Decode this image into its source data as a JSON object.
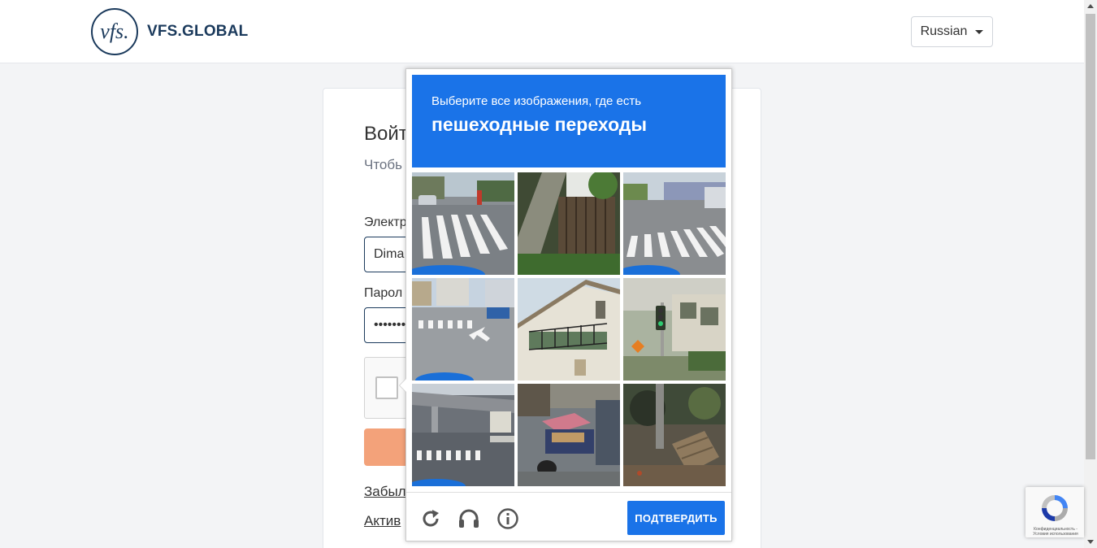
{
  "header": {
    "logo_mark": "vfs.",
    "logo_text": "VFS.GLOBAL",
    "language_selected": "Russian"
  },
  "login": {
    "title": "Войт",
    "subtitle": "Чтобь почты",
    "email_label": "Электр",
    "email_value": "Dima",
    "password_label": "Парол",
    "password_value": "•••••••",
    "forgot_link": "Забыл",
    "activate_link": "Актив"
  },
  "challenge": {
    "instruction": "Выберите все изображения, где есть",
    "target": "пешеходные переходы",
    "verify_label": "ПОДТВЕРДИТЬ",
    "accent": "#1a73e8",
    "tiles": [
      {
        "scene": "crosswalk-street"
      },
      {
        "scene": "tree-fence"
      },
      {
        "scene": "crosswalk-wide-road"
      },
      {
        "scene": "intersection-crosswalk"
      },
      {
        "scene": "building-balcony"
      },
      {
        "scene": "traffic-light-pole"
      },
      {
        "scene": "overpass-crosswalk"
      },
      {
        "scene": "market-stall"
      },
      {
        "scene": "debris-bushes"
      }
    ],
    "icons": [
      "reload-icon",
      "audio-icon",
      "info-icon"
    ]
  },
  "badge": {
    "text": "Конфиденциальность - Условия использования"
  }
}
